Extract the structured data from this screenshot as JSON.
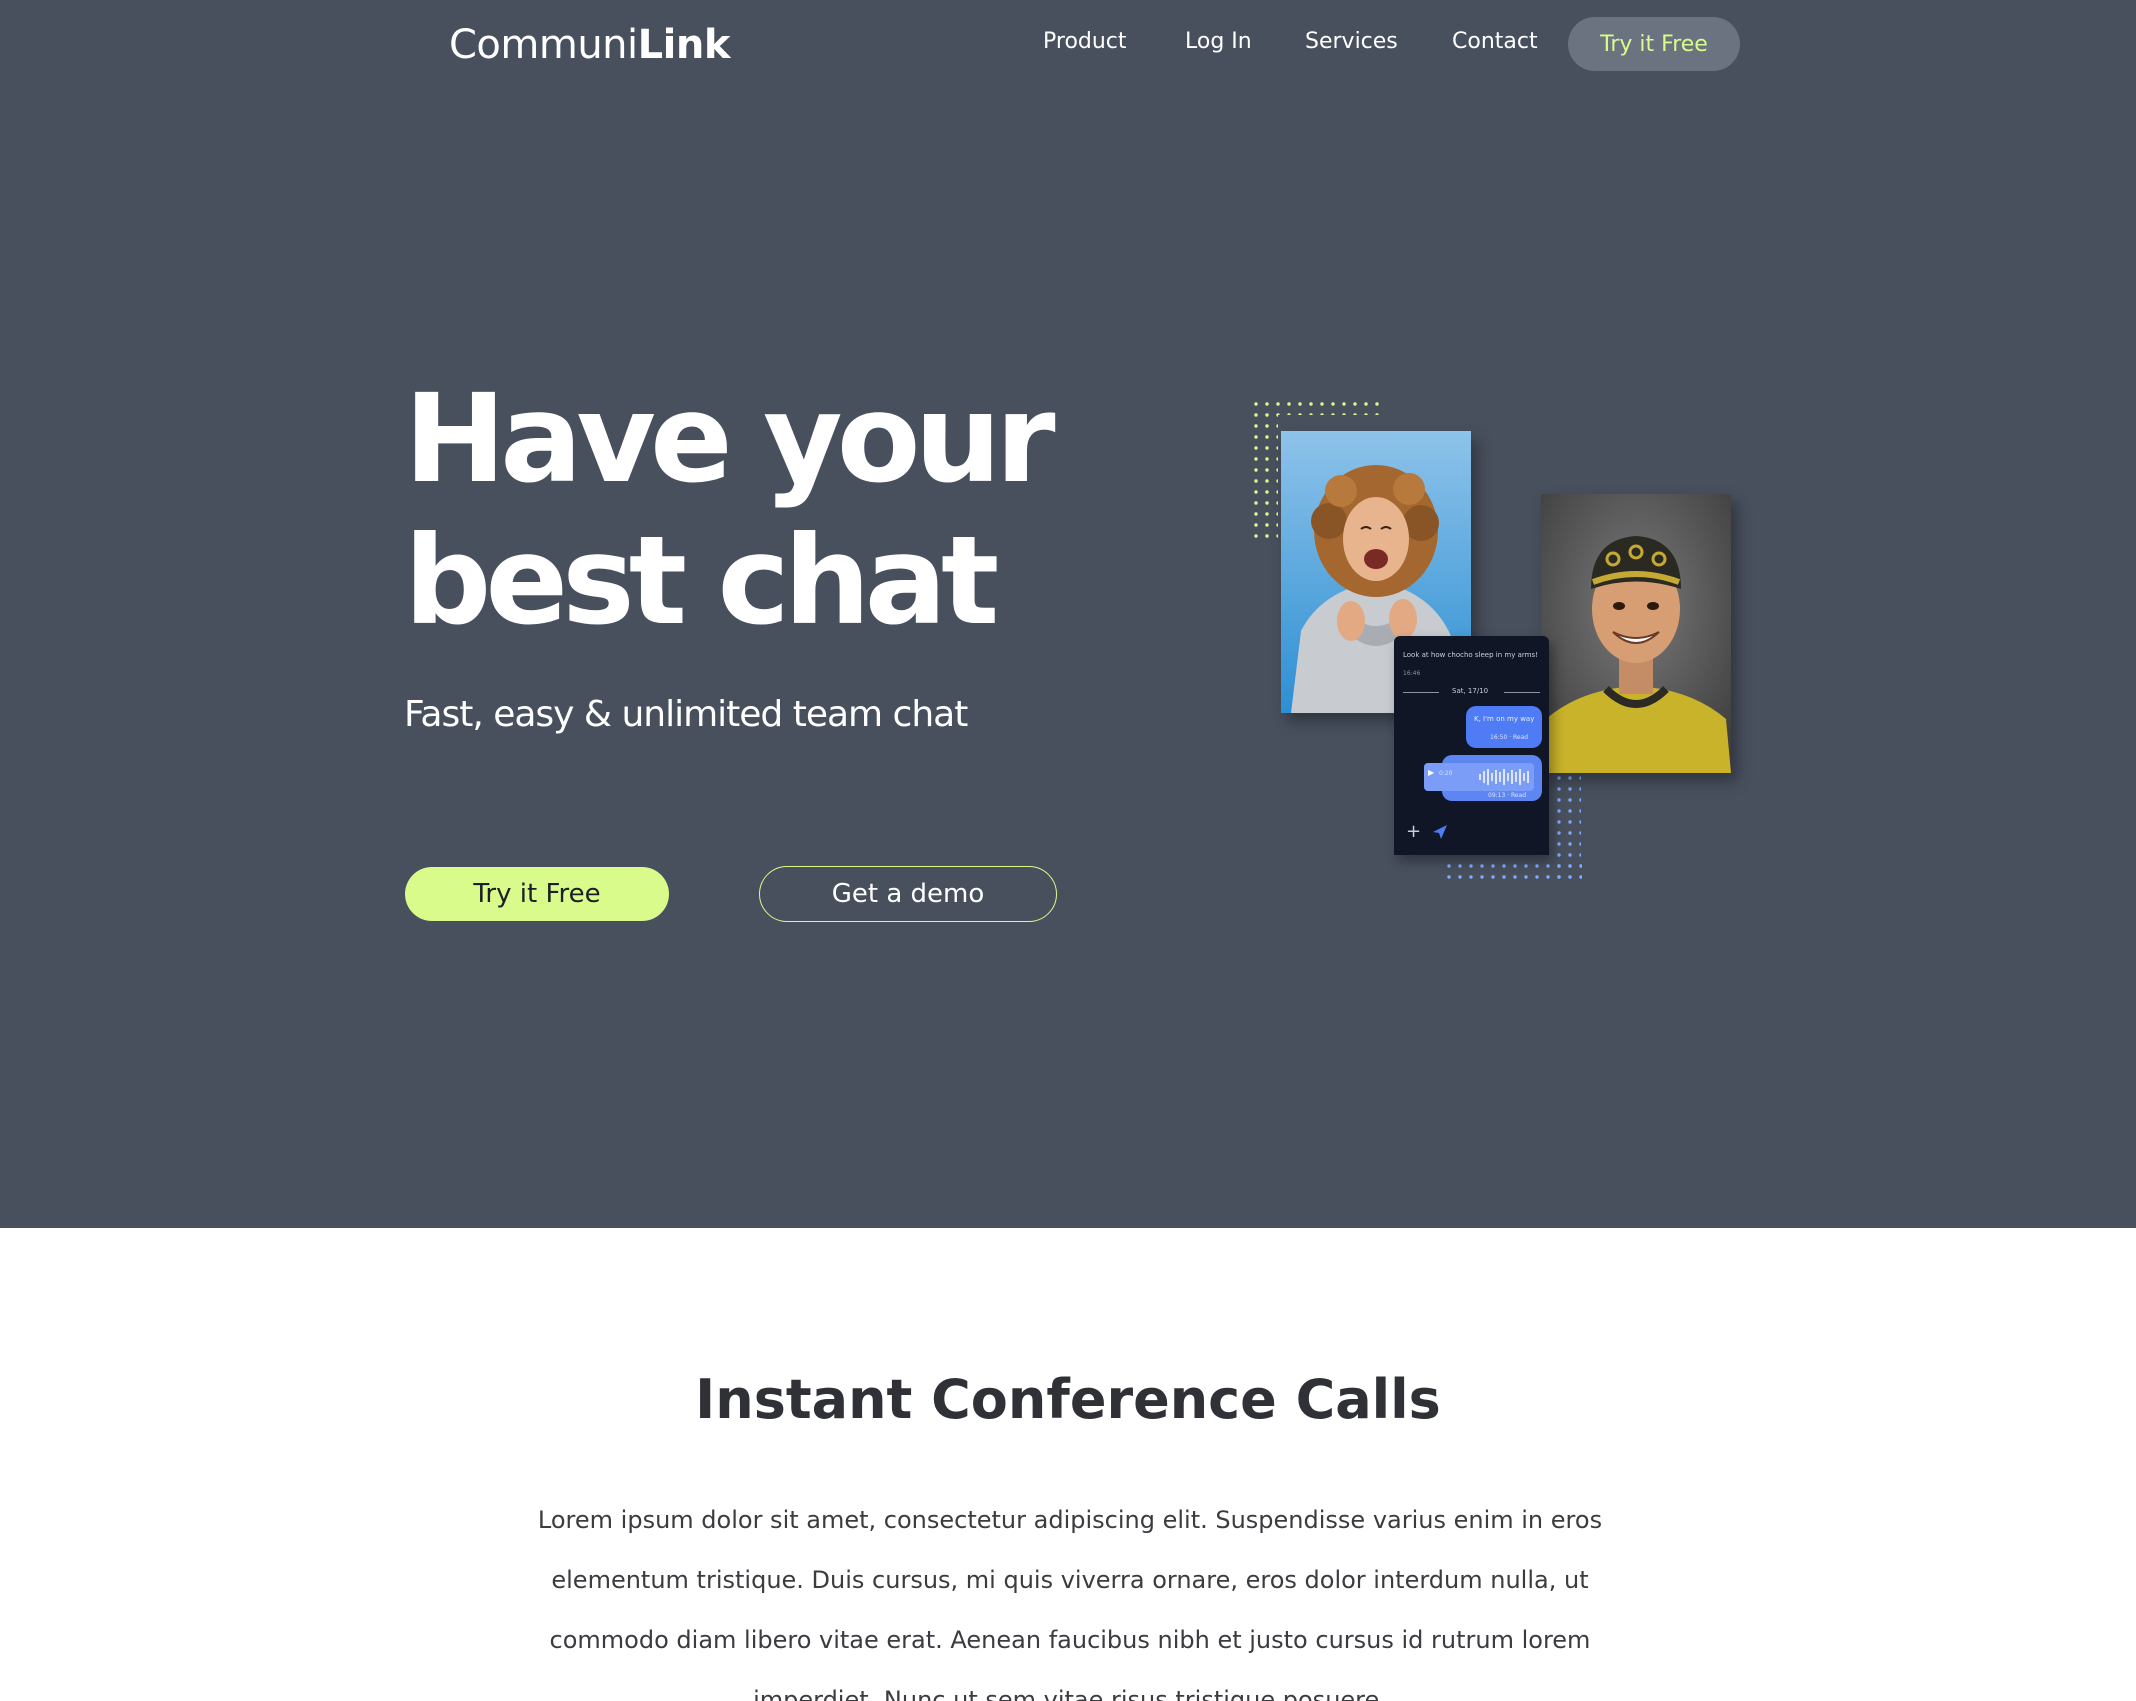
{
  "brand": {
    "logo_light": "Communi",
    "logo_bold": "Link"
  },
  "nav": {
    "items": [
      {
        "label": "Product"
      },
      {
        "label": "Log In"
      },
      {
        "label": "Services"
      },
      {
        "label": "Contact"
      }
    ],
    "cta_label": "Try it Free"
  },
  "hero": {
    "headline_line1": "Have your",
    "headline_line2": "best chat",
    "subheading": "Fast, easy & unlimited team chat",
    "primary_button": "Try it Free",
    "secondary_button": "Get a demo"
  },
  "chat_mockup": {
    "message_text": "Look at how chocho sleep in my arms!",
    "message_time": "16:46",
    "date_divider": "Sat, 17/10",
    "reply_text": "K, I'm on my way",
    "reply_meta": "16:50 · Read",
    "voice_duration": "0:20",
    "voice_meta": "09:13 · Read"
  },
  "section": {
    "title": "Instant Conference Calls",
    "body": "Lorem ipsum dolor sit amet, consectetur adipiscing elit. Suspendisse varius enim in eros elementum tristique. Duis cursus, mi quis viverra ornare, eros dolor interdum nulla, ut commodo diam libero vitae erat. Aenean faucibus nibh et justo cursus id rutrum lorem imperdiet. Nunc ut sem vitae risus tristique posuere."
  },
  "colors": {
    "hero_bg": "#48505e",
    "accent": "#d8fb8c",
    "chat_blue": "#4f7cf5",
    "chat_bg": "#101625"
  },
  "icons": [
    "plus-icon",
    "send-icon",
    "play-icon",
    "waveform-icon"
  ]
}
